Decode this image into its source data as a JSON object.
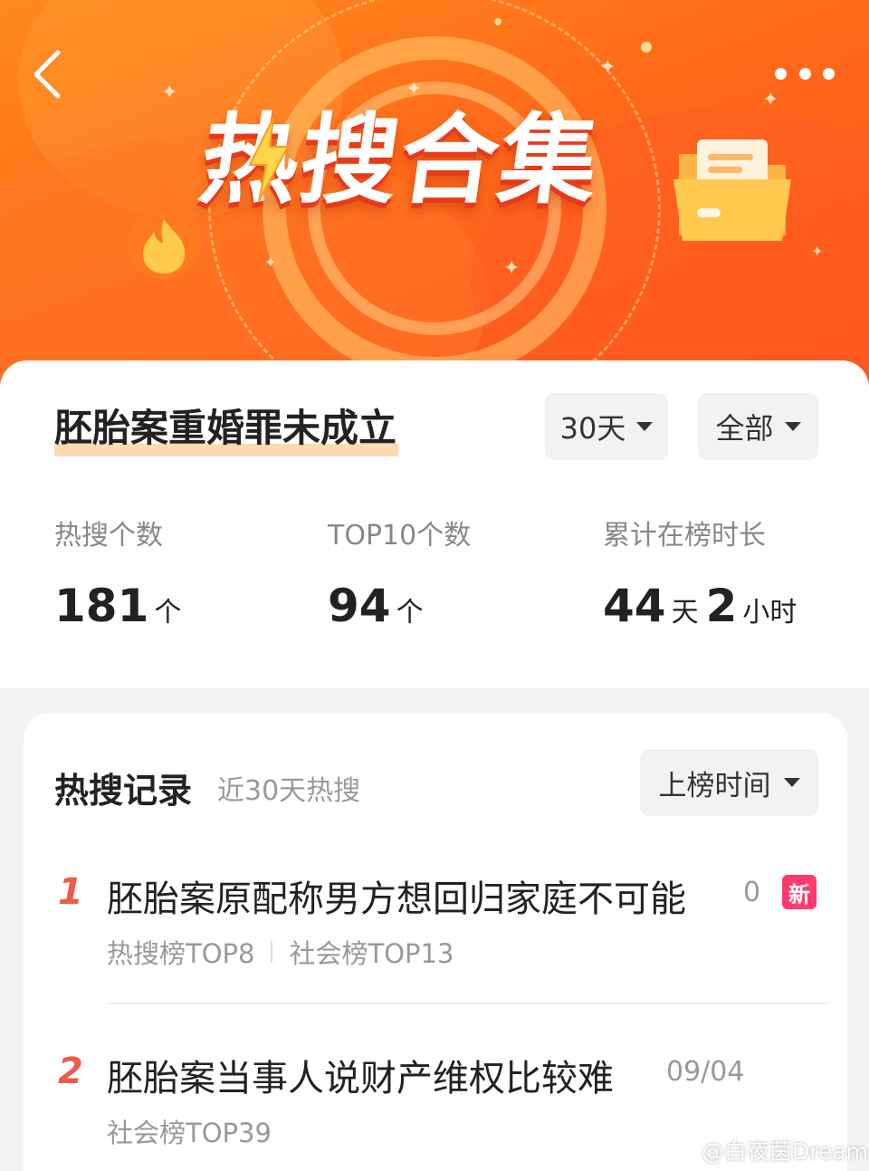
{
  "header": {
    "banner_title": "热搜合集",
    "back_icon": "back-chevron-icon",
    "more_icon": "more-dots-icon",
    "colors": {
      "banner_start": "#ff8a1c",
      "banner_end": "#ff4e1e"
    }
  },
  "summary": {
    "topic": "胚胎案重婚罪未成立",
    "filter_days": "30天",
    "filter_scope": "全部",
    "stats": [
      {
        "label": "热搜个数",
        "value": "181",
        "unit": "个"
      },
      {
        "label": "TOP10个数",
        "value": "94",
        "unit": "个"
      },
      {
        "label": "累计在榜时长",
        "value_days": "44",
        "unit_days": "天",
        "value_hours": "2",
        "unit_hours": "小时"
      }
    ]
  },
  "records": {
    "title": "热搜记录",
    "subtitle": "近30天热搜",
    "sort_label": "上榜时间",
    "items": [
      {
        "rank": "1",
        "title": "胚胎案原配称男方想回归家庭不可能",
        "meta": "0",
        "badge": "新",
        "tags": [
          "热搜榜TOP8",
          "社会榜TOP13"
        ]
      },
      {
        "rank": "2",
        "title": "胚胎案当事人说财产维权比较难",
        "meta": "09/04",
        "tags": [
          "社会榜TOP39"
        ]
      }
    ],
    "accent_color": "#f05a46"
  },
  "watermark": "@白夜茵Dream"
}
